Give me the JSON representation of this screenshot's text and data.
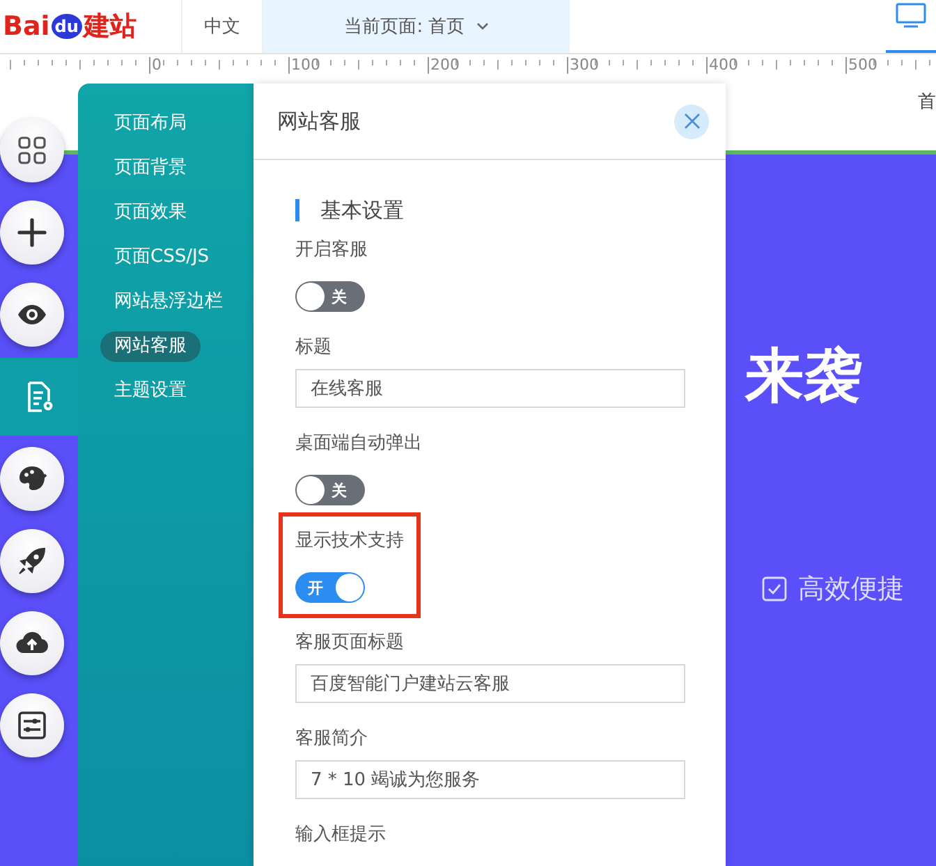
{
  "header": {
    "logo": {
      "text_1": "Bai",
      "text_2": "du",
      "text_3": "建站"
    },
    "tabs": [
      {
        "label": "中文",
        "selected": false
      },
      {
        "label": "当前页面: 首页",
        "selected": true
      }
    ],
    "device_tab": {
      "selected": true
    }
  },
  "ruler": {
    "labels": [
      "0",
      "100",
      "200",
      "300",
      "400",
      "500"
    ]
  },
  "canvas": {
    "nav_text": "首",
    "headline": "来袭",
    "feature": "高效便捷"
  },
  "rail": [
    {
      "selected": false
    },
    {
      "selected": false
    },
    {
      "selected": false
    },
    {
      "selected": true
    },
    {
      "selected": false
    },
    {
      "selected": false
    },
    {
      "selected": false
    },
    {
      "selected": false
    }
  ],
  "menu": [
    {
      "label": "页面布局",
      "selected": false
    },
    {
      "label": "页面背景",
      "selected": false
    },
    {
      "label": "页面效果",
      "selected": false
    },
    {
      "label": "页面CSS/JS",
      "selected": false
    },
    {
      "label": "网站悬浮边栏",
      "selected": false
    },
    {
      "label": "网站客服",
      "selected": true
    },
    {
      "label": "主题设置",
      "selected": false
    }
  ],
  "panel": {
    "title": "网站客服",
    "section": "基本设置",
    "fields": [
      {
        "kind": "switch",
        "label": "开启客服",
        "on": false,
        "text": "关",
        "highlighted": false
      },
      {
        "kind": "input",
        "label": "标题",
        "value": "在线客服"
      },
      {
        "kind": "switch",
        "label": "桌面端自动弹出",
        "on": false,
        "text": "关",
        "highlighted": false
      },
      {
        "kind": "switch",
        "label": "显示技术支持",
        "on": true,
        "text": "开",
        "highlighted": true
      },
      {
        "kind": "input",
        "label": "客服页面标题",
        "value": "百度智能门户建站云客服"
      },
      {
        "kind": "input",
        "label": "客服简介",
        "value": "7 * 10 竭诚为您服务"
      },
      {
        "kind": "label",
        "label": "输入框提示"
      }
    ]
  }
}
